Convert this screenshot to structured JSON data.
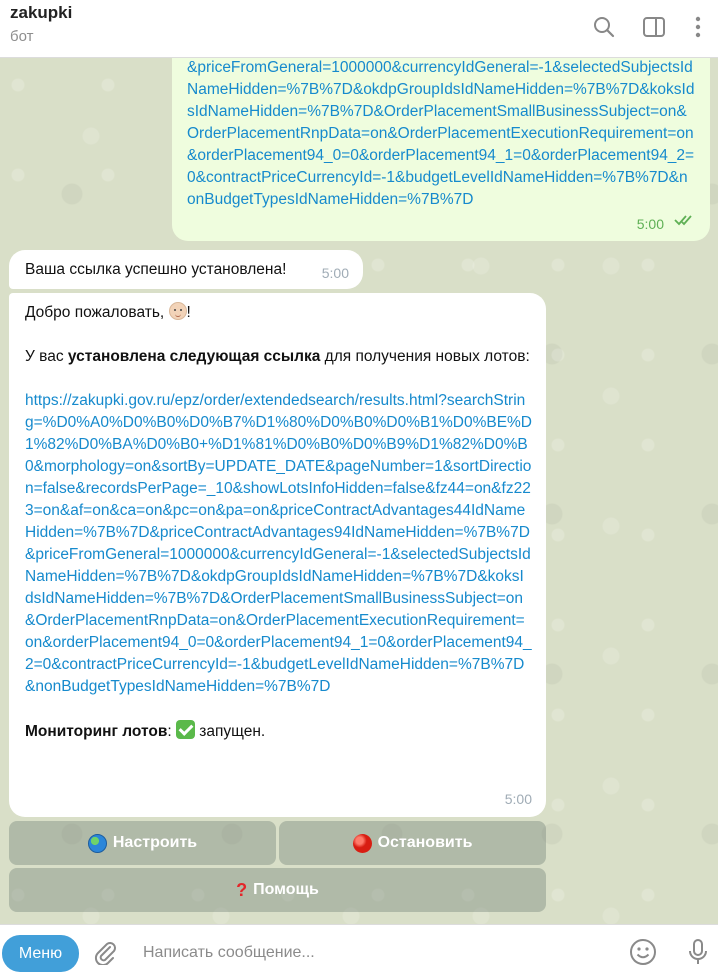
{
  "header": {
    "chat_title": "zakupki",
    "chat_status": "бот"
  },
  "messages": {
    "outgoing": {
      "text": "&priceFromGeneral=1000000&currencyIdGeneral=-1&selectedSubjectsIdNameHidden=%7B%7D&okdpGroupIdsIdNameHidden=%7B%7D&koksIdsIdNameHidden=%7B%7D&OrderPlacementSmallBusinessSubject=on&OrderPlacementRnpData=on&OrderPlacementExecutionRequirement=on&orderPlacement94_0=0&orderPlacement94_1=0&orderPlacement94_2=0&contractPriceCurrencyId=-1&budgetLevelIdNameHidden=%7B%7D&nonBudgetTypesIdNameHidden=%7B%7D",
      "time": "5:00",
      "status": "read"
    },
    "incoming_1": {
      "text": "Ваша ссылка успешно установлена!",
      "time": "5:00"
    },
    "incoming_2": {
      "greeting": "Добро пожаловать,",
      "greeting_end": "!",
      "intro_prefix": "У вас ",
      "intro_bold": "установлена следующая ссылка",
      "intro_suffix": " для получения новых лотов:",
      "link": "https://zakupki.gov.ru/epz/order/extendedsearch/results.html?searchString=%D0%A0%D0%B0%D0%B7%D1%80%D0%B0%D0%B1%D0%BE%D1%82%D0%BA%D0%B0+%D1%81%D0%B0%D0%B9%D1%82%D0%B0&morphology=on&sortBy=UPDATE_DATE&pageNumber=1&sortDirection=false&recordsPerPage=_10&showLotsInfoHidden=false&fz44=on&fz223=on&af=on&ca=on&pc=on&pa=on&priceContractAdvantages44IdNameHidden=%7B%7D&priceContractAdvantages94IdNameHidden=%7B%7D&priceFromGeneral=1000000&currencyIdGeneral=-1&selectedSubjectsIdNameHidden=%7B%7D&okdpGroupIdsIdNameHidden=%7B%7D&koksIdsIdNameHidden=%7B%7D&OrderPlacementSmallBusinessSubject=on&OrderPlacementRnpData=on&OrderPlacementExecutionRequirement=on&orderPlacement94_0=0&orderPlacement94_1=0&orderPlacement94_2=0&contractPriceCurrencyId=-1&budgetLevelIdNameHidden=%7B%7D&nonBudgetTypesIdNameHidden=%7B%7D",
      "monitoring_label": "Мониторинг лотов",
      "monitoring_colon": ":",
      "monitoring_status": " запущен.",
      "time": "5:00"
    }
  },
  "keyboard": {
    "configure_label": "Настроить",
    "configure_icon": "globe-icon",
    "stop_label": "Остановить",
    "stop_icon": "red-circle-icon",
    "help_label": "Помощь",
    "help_icon": "red-question-mark-icon"
  },
  "footer": {
    "menu_label": "Меню",
    "input_placeholder": "Написать сообщение...",
    "input_value": ""
  },
  "colors": {
    "accent": "#419fd9",
    "outgoing_bubble": "#effdde",
    "link": "#168acd",
    "read_check": "#5fb055"
  }
}
